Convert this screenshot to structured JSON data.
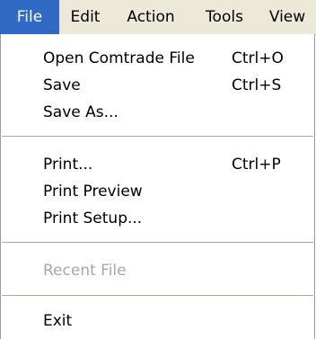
{
  "menubar": {
    "items": [
      {
        "label": "File"
      },
      {
        "label": "Edit"
      },
      {
        "label": "Action"
      },
      {
        "label": "Tools"
      },
      {
        "label": "View"
      }
    ]
  },
  "file_menu": {
    "open": {
      "label": "Open Comtrade File",
      "shortcut": "Ctrl+O"
    },
    "save": {
      "label": "Save",
      "shortcut": "Ctrl+S"
    },
    "save_as": {
      "label": "Save As..."
    },
    "print": {
      "label": "Print...",
      "shortcut": "Ctrl+P"
    },
    "print_preview": {
      "label": "Print Preview"
    },
    "print_setup": {
      "label": "Print Setup..."
    },
    "recent_file": {
      "label": "Recent File"
    },
    "exit": {
      "label": "Exit"
    }
  }
}
